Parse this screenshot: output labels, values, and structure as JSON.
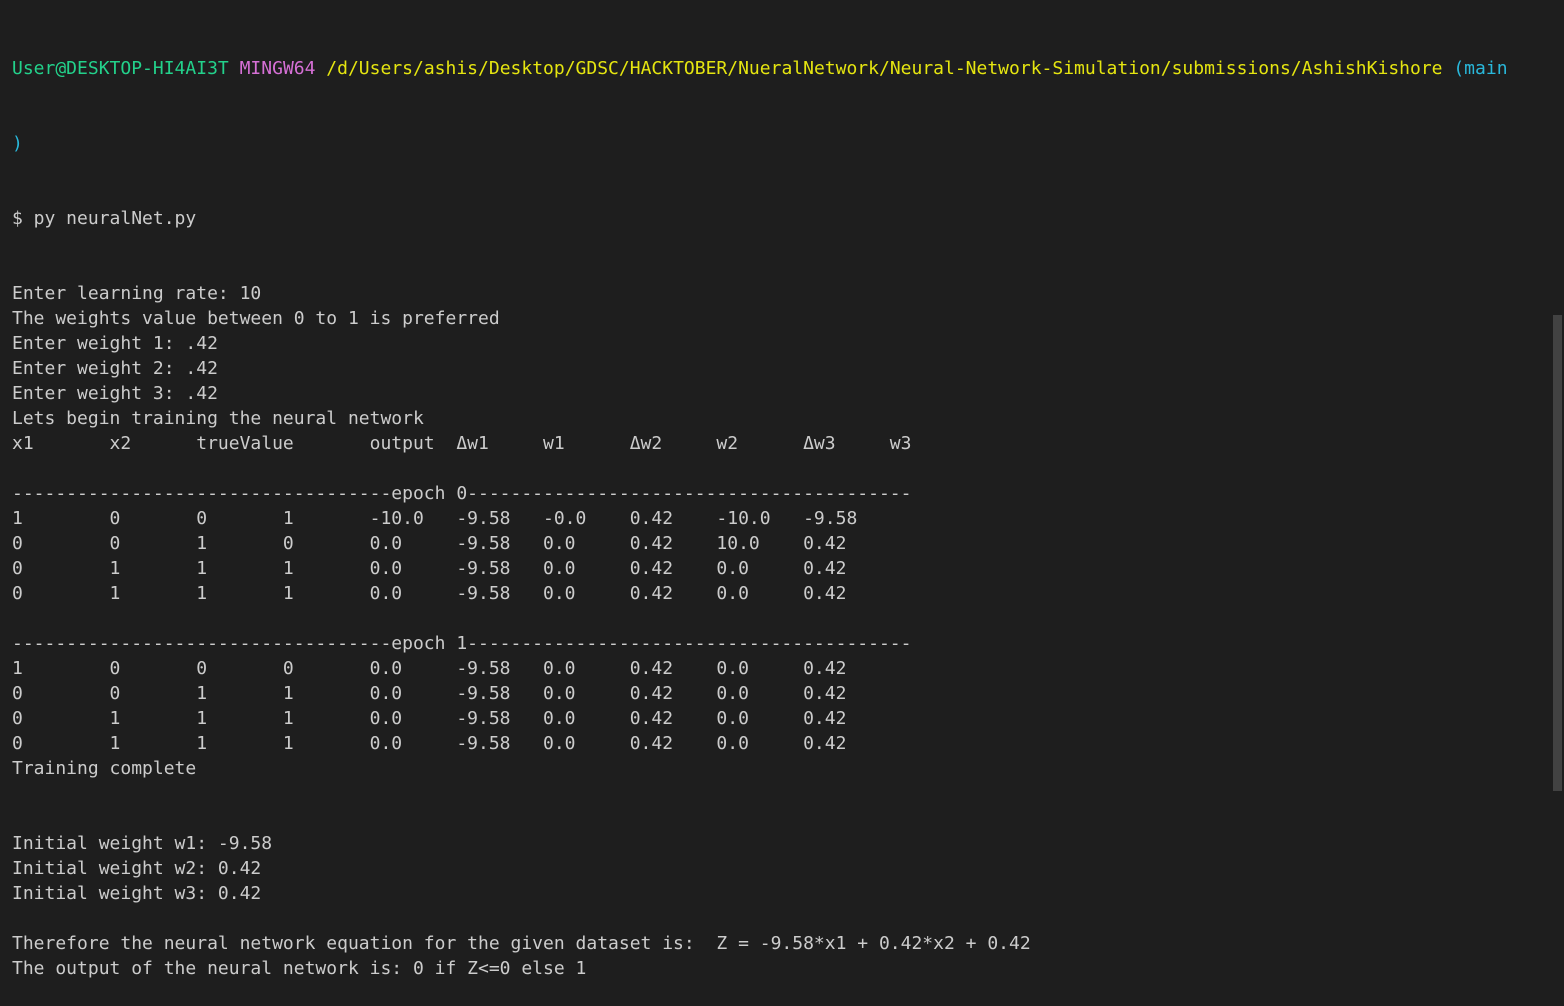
{
  "prompt": {
    "user_host": "User@DESKTOP-HI4AI3T",
    "env": "MINGW64",
    "path": "/d/Users/ashis/Desktop/GDSC/HACKTOBER/NueralNetwork/Neural-Network-Simulation/submissions/AshishKishore",
    "branch_open": "(main",
    "branch_close": ")"
  },
  "command": "$ py neuralNet.py",
  "output_lines": [
    "Enter learning rate: 10",
    "The weights value between 0 to 1 is preferred",
    "Enter weight 1: .42",
    "Enter weight 2: .42",
    "Enter weight 3: .42",
    "Lets begin training the neural network",
    "x1       x2      trueValue       output  Δw1     w1      Δw2     w2      Δw3     w3",
    "",
    "-----------------------------------epoch 0-----------------------------------------",
    "1        0       0       1       -10.0   -9.58   -0.0    0.42    -10.0   -9.58",
    "0        0       1       0       0.0     -9.58   0.0     0.42    10.0    0.42",
    "0        1       1       1       0.0     -9.58   0.0     0.42    0.0     0.42",
    "0        1       1       1       0.0     -9.58   0.0     0.42    0.0     0.42",
    "",
    "-----------------------------------epoch 1-----------------------------------------",
    "1        0       0       0       0.0     -9.58   0.0     0.42    0.0     0.42",
    "0        0       1       1       0.0     -9.58   0.0     0.42    0.0     0.42",
    "0        1       1       1       0.0     -9.58   0.0     0.42    0.0     0.42",
    "0        1       1       1       0.0     -9.58   0.0     0.42    0.0     0.42",
    "Training complete",
    "",
    "",
    "Initial weight w1: -9.58",
    "Initial weight w2: 0.42",
    "Initial weight w3: 0.42",
    "",
    "Therefore the neural network equation for the given dataset is:  Z = -9.58*x1 + 0.42*x2 + 0.42",
    "The output of the neural network is: 0 if Z<=0 else 1"
  ],
  "colors": {
    "background": "#1e1e1e",
    "text": "#cccccc",
    "user_host": "#23d18b",
    "env": "#d670d6",
    "path": "#e5e510",
    "branch": "#29b8db"
  }
}
